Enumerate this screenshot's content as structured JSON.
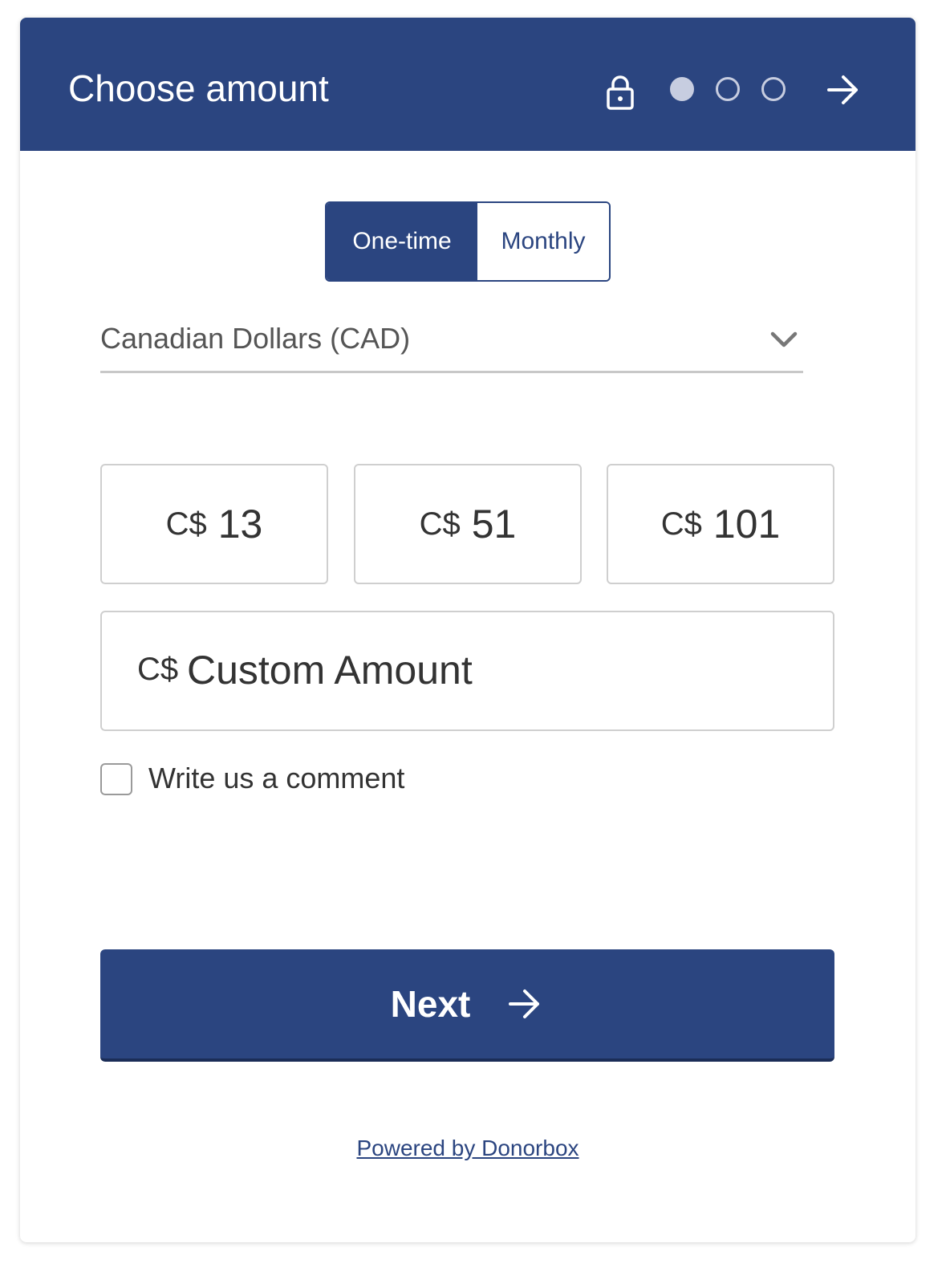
{
  "header": {
    "title": "Choose amount",
    "background_color": "#2b4580",
    "steps": {
      "total": 3,
      "current": 1
    },
    "icons": {
      "lock": "lock-icon",
      "next": "arrow-right-icon"
    }
  },
  "frequency": {
    "options": [
      "One-time",
      "Monthly"
    ],
    "selected": "One-time"
  },
  "currency": {
    "selected": "Canadian Dollars (CAD)",
    "icon": "chevron-down-icon"
  },
  "amounts": [
    {
      "currency": "C$",
      "value": "13"
    },
    {
      "currency": "C$",
      "value": "51"
    },
    {
      "currency": "C$",
      "value": "101"
    }
  ],
  "custom_amount": {
    "currency": "C$",
    "placeholder": "Custom Amount"
  },
  "comment": {
    "label": "Write us a comment",
    "checked": false
  },
  "next_button": {
    "label": "Next",
    "icon": "arrow-right-icon"
  },
  "footer": {
    "powered_by": "Powered by Donorbox"
  },
  "colors": {
    "primary": "#2b4580",
    "border": "#cfcfcf",
    "text": "#333333"
  }
}
